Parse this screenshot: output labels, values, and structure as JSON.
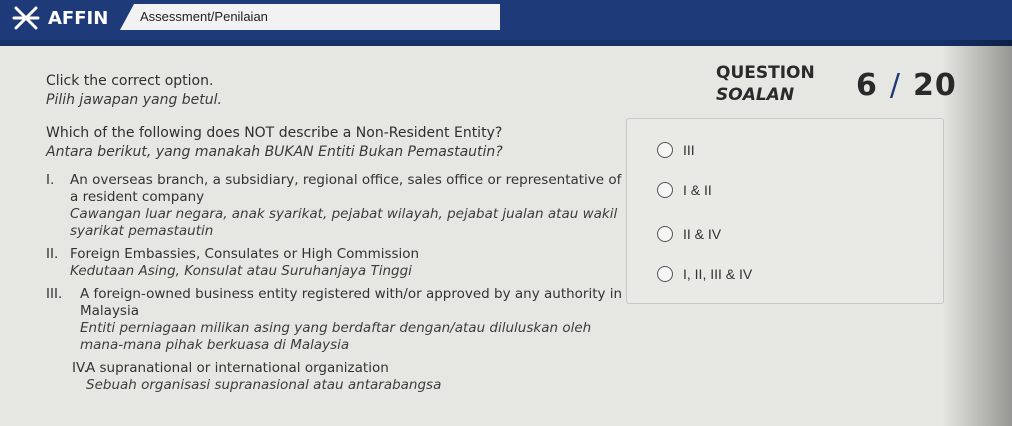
{
  "header": {
    "brand": "AFFIN",
    "tab_title": "Assessment/Penilaian"
  },
  "instruction": {
    "en": "Click the correct option.",
    "ms": "Pilih jawapan yang betul."
  },
  "question_label": {
    "en": "QUESTION",
    "ms": "SOALAN"
  },
  "progress": {
    "current": "6",
    "total": "20"
  },
  "question": {
    "en": "Which of the following does NOT describe a Non-Resident Entity?",
    "ms": "Antara berikut, yang manakah BUKAN Entiti Bukan Pemastautin?"
  },
  "items": [
    {
      "num": "I.",
      "en": "An overseas branch, a subsidiary, regional office, sales office or representative of a resident company",
      "ms": "Cawangan luar negara, anak syarikat, pejabat wilayah, pejabat jualan atau wakil syarikat pemastautin"
    },
    {
      "num": "II.",
      "en": "Foreign Embassies, Consulates or High Commission",
      "ms": "Kedutaan Asing, Konsulat atau Suruhanjaya Tinggi"
    },
    {
      "num": "III.",
      "en": "A foreign-owned business entity registered with/or approved by any authority in Malaysia",
      "ms": "Entiti perniagaan milikan asing yang berdaftar dengan/atau diluluskan oleh mana-mana pihak berkuasa di Malaysia"
    },
    {
      "num": "IV.",
      "en": "A supranational or international organization",
      "ms": "Sebuah organisasi supranasional atau antarabangsa"
    }
  ],
  "options": [
    {
      "label": "III"
    },
    {
      "label": "I & II"
    },
    {
      "label": "II & IV"
    },
    {
      "label": "I, II, III & IV"
    }
  ],
  "colors": {
    "header_bg": "#1e3a78",
    "page_bg": "#e6e6e2"
  }
}
